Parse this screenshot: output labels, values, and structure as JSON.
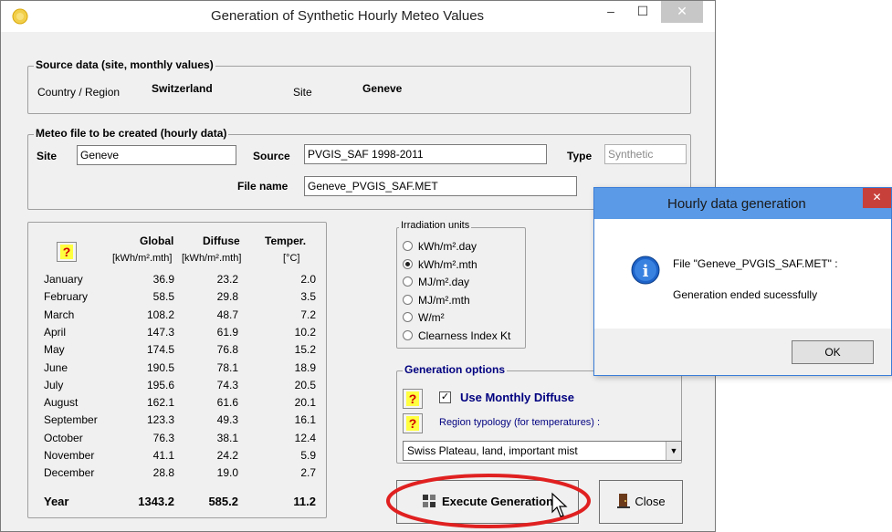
{
  "main_window": {
    "title": "Generation of Synthetic Hourly Meteo Values",
    "minimize_glyph": "–",
    "maximize_glyph": "☐",
    "close_glyph": "✕",
    "app_icon": "sun-icon"
  },
  "source_data": {
    "group_label": "Source data  (site, monthly values)",
    "country_label": "Country / Region",
    "country_value": "Switzerland",
    "site_label": "Site",
    "site_value": "Geneve"
  },
  "meteo_file": {
    "group_label": "Meteo file to be created (hourly data)",
    "site_label": "Site",
    "site_value": "Geneve",
    "source_label": "Source",
    "source_value": "PVGIS_SAF 1998-2011",
    "type_label": "Type",
    "type_value": "Synthetic",
    "filename_label": "File name",
    "filename_value": "Geneve_PVGIS_SAF.MET"
  },
  "table": {
    "help_glyph": "?",
    "headers": {
      "global": "Global",
      "diffuse": "Diffuse",
      "temper": "Temper.",
      "global_unit": "[kWh/m².mth]",
      "diffuse_unit": "[kWh/m².mth]",
      "temper_unit": "[°C]"
    },
    "rows": [
      {
        "month": "January",
        "global": "36.9",
        "diffuse": "23.2",
        "temp": "2.0"
      },
      {
        "month": "February",
        "global": "58.5",
        "diffuse": "29.8",
        "temp": "3.5"
      },
      {
        "month": "March",
        "global": "108.2",
        "diffuse": "48.7",
        "temp": "7.2"
      },
      {
        "month": "April",
        "global": "147.3",
        "diffuse": "61.9",
        "temp": "10.2"
      },
      {
        "month": "May",
        "global": "174.5",
        "diffuse": "76.8",
        "temp": "15.2"
      },
      {
        "month": "June",
        "global": "190.5",
        "diffuse": "78.1",
        "temp": "18.9"
      },
      {
        "month": "July",
        "global": "195.6",
        "diffuse": "74.3",
        "temp": "20.5"
      },
      {
        "month": "August",
        "global": "162.1",
        "diffuse": "61.6",
        "temp": "20.1"
      },
      {
        "month": "September",
        "global": "123.3",
        "diffuse": "49.3",
        "temp": "16.1"
      },
      {
        "month": "October",
        "global": "76.3",
        "diffuse": "38.1",
        "temp": "12.4"
      },
      {
        "month": "November",
        "global": "41.1",
        "diffuse": "24.2",
        "temp": "5.9"
      },
      {
        "month": "December",
        "global": "28.8",
        "diffuse": "19.0",
        "temp": "2.7"
      }
    ],
    "year": {
      "label": "Year",
      "global": "1343.2",
      "diffuse": "585.2",
      "temp": "11.2"
    }
  },
  "irradiation_units": {
    "group_label": "Irradiation units",
    "options": [
      "kWh/m².day",
      "kWh/m².mth",
      "MJ/m².day",
      "MJ/m².mth",
      "W/m²",
      "Clearness Index Kt"
    ],
    "selected": "kWh/m².mth"
  },
  "generation_options": {
    "group_label": "Generation options",
    "use_monthly_diffuse_label": "Use Monthly Diffuse",
    "use_monthly_diffuse_checked": true,
    "check_glyph": "✓",
    "region_typology_label": "Region typology  (for temperatures) :",
    "region_value": "Swiss Plateau, land, important mist",
    "dropdown_glyph": "▼"
  },
  "buttons": {
    "execute_label": "Execute Generation",
    "close_label": "Close"
  },
  "dialog": {
    "title": "Hourly data generation",
    "close_glyph": "✕",
    "info_glyph": "i",
    "message_line1": "File \"Geneve_PVGIS_SAF.MET\" :",
    "message_line2": "Generation ended sucessfully",
    "ok_label": "OK"
  },
  "colors": {
    "highlight_ellipse": "#e02020",
    "dialog_title_bar": "#5b9ae6",
    "dialog_close": "#c8403a",
    "group_label_blue": "#000080",
    "info_icon": "#1e63c8"
  }
}
